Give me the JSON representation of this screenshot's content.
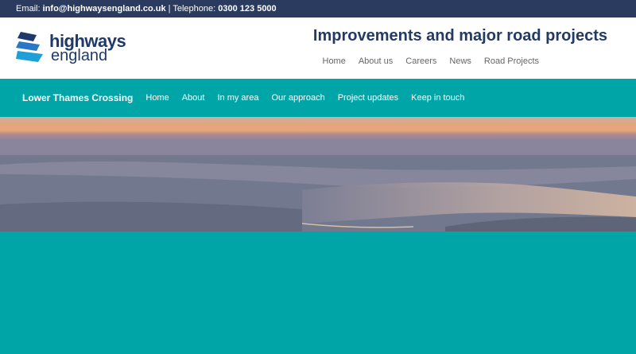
{
  "topbar": {
    "email_label": "Email:",
    "email": "info@highwaysengland.co.uk",
    "separator": "|",
    "phone_label": "Telephone:",
    "phone": "0300 123 5000"
  },
  "header": {
    "logo": {
      "line1": "highways",
      "line2": "england"
    },
    "site_title": "Improvements and major road projects",
    "util_nav": [
      "Home",
      "About us",
      "Careers",
      "News",
      "Road Projects"
    ]
  },
  "mainnav": {
    "brand": "Lower Thames Crossing",
    "items": [
      "Home",
      "About",
      "In my area",
      "Our approach",
      "Project updates",
      "Keep in touch"
    ]
  },
  "colors": {
    "topbar": "#2b3b5f",
    "accent": "#00a5a7",
    "title": "#233a63"
  }
}
